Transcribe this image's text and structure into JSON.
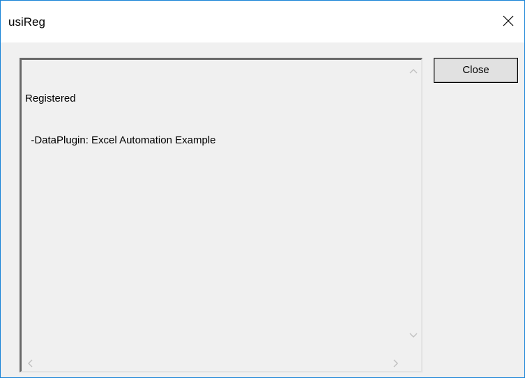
{
  "window": {
    "title": "usiReg"
  },
  "textbox": {
    "lines": [
      "Registered",
      "  -DataPlugin: Excel Automation Example"
    ]
  },
  "buttons": {
    "close_label": "Close"
  },
  "icons": {
    "title_close": "close-icon",
    "scroll_up": "chevron-up-icon",
    "scroll_down": "chevron-down-icon",
    "scroll_left": "chevron-left-icon",
    "scroll_right": "chevron-right-icon"
  },
  "colors": {
    "window_border": "#1883d7",
    "dialog_background": "#f0f0f0",
    "button_background": "#e1e1e1"
  }
}
